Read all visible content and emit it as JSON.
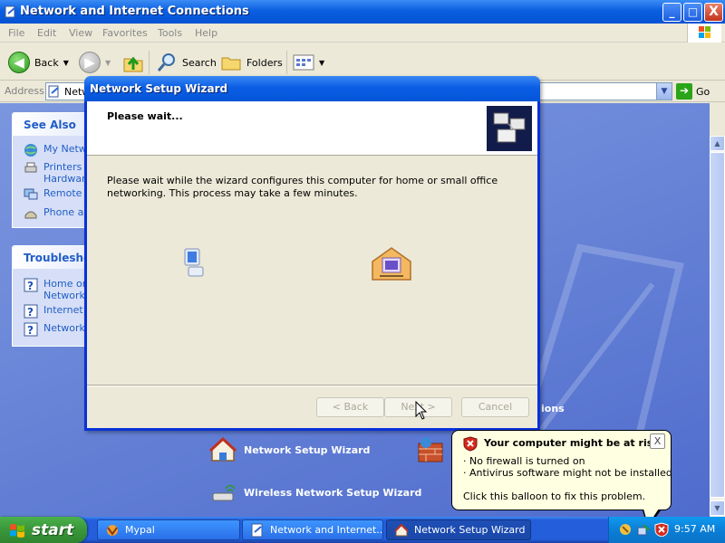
{
  "explorer": {
    "title": "Network and Internet Connections",
    "caption_buttons": {
      "minimize": "_",
      "maximize": "□",
      "close": "X"
    },
    "menu": [
      "File",
      "Edit",
      "View",
      "Favorites",
      "Tools",
      "Help"
    ],
    "toolbar": {
      "back": "Back",
      "search": "Search",
      "folders": "Folders"
    },
    "address": {
      "label": "Address",
      "value": "Netw",
      "go": "Go"
    },
    "see_also": {
      "heading": "See Also",
      "items": [
        [
          "My Netw"
        ],
        [
          "Printers a",
          "Hardware"
        ],
        [
          "Remote D"
        ],
        [
          "Phone an"
        ]
      ]
    },
    "troubleshooters": {
      "heading": "Troubleshoot",
      "items": [
        [
          "Home or",
          "Networkin"
        ],
        [
          "Internet"
        ],
        [
          "Network"
        ]
      ]
    },
    "tasks": {
      "partial_label": "ions",
      "network_setup": "Network Setup Wizard",
      "wireless_setup": "Wireless Network Setup Wizard"
    }
  },
  "wizard": {
    "title": "Network Setup Wizard",
    "heading": "Please wait...",
    "description": "Please wait while the wizard configures this computer for home or small office networking. This process may take a few minutes.",
    "buttons": {
      "back": "< Back",
      "next": "Next >",
      "cancel": "Cancel"
    }
  },
  "taskbar": {
    "start": "start",
    "tasks": [
      "Mypal",
      "Network and Internet...",
      "Network Setup Wizard"
    ],
    "clock": "9:57 AM"
  },
  "balloon": {
    "title": "Your computer might be at risk",
    "close": "X",
    "lines": [
      "· No firewall is turned on",
      "· Antivirus software might not be installed"
    ],
    "action": "Click this balloon to fix this problem."
  },
  "colors": {
    "title_bar": "#0a5fe0",
    "link_blue": "#215dc6",
    "desktop_blue": "#5a7edc",
    "balloon_bg": "#ffffe1",
    "start_green": "#3c9b3c"
  }
}
